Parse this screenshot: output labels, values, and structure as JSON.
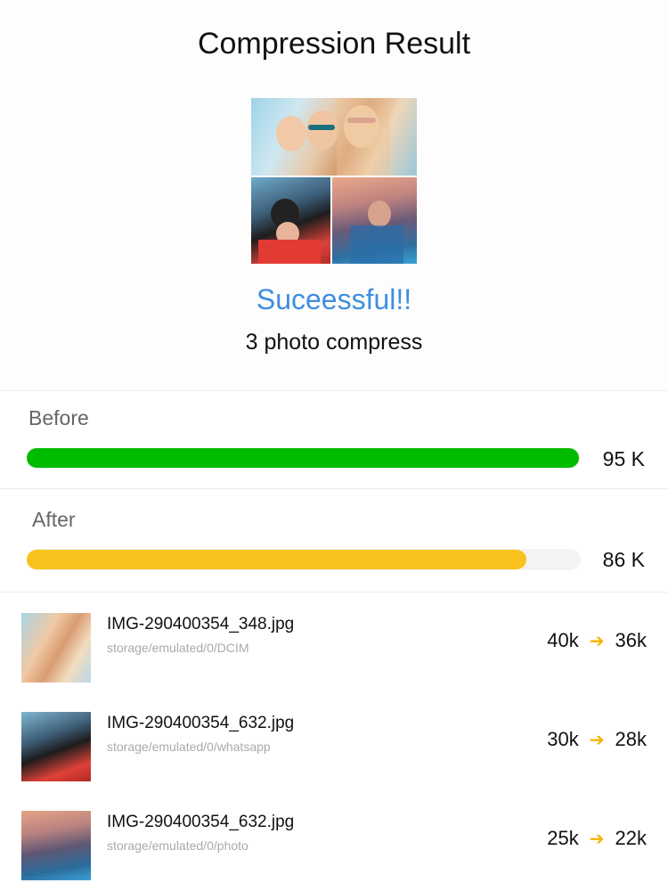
{
  "header": {
    "title": "Compression Result"
  },
  "preview": {
    "image_name": "photo-collage",
    "status": "Suceessful!!",
    "summary": "3 photo compress"
  },
  "before": {
    "label": "Before",
    "value_text": "95 K",
    "fill_fraction": 1.0,
    "color": "#00bb00"
  },
  "after": {
    "label": "After",
    "value_text": "86 K",
    "fill_fraction": 0.905,
    "color": "#f9c21c"
  },
  "files": [
    {
      "name": "IMG-290400354_348.jpg",
      "path": "storage/emulated/0/DCIM",
      "size_before": "40k",
      "size_after": "36k"
    },
    {
      "name": "IMG-290400354_632.jpg",
      "path": "storage/emulated/0/whatsapp",
      "size_before": "30k",
      "size_after": "28k"
    },
    {
      "name": "IMG-290400354_632.jpg",
      "path": "storage/emulated/0/photo",
      "size_before": "25k",
      "size_after": "22k"
    }
  ],
  "colors": {
    "accent_blue": "#3f8fe0",
    "arrow": "#f5b400"
  },
  "icons": {
    "arrow": "arrow-right-icon"
  }
}
